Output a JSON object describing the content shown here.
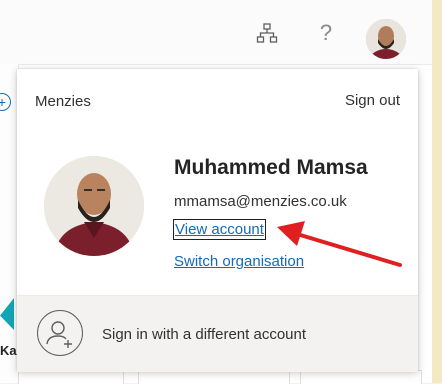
{
  "topbar": {
    "org_icon": "org-chart-icon",
    "help_icon": "question-mark-icon",
    "help_glyph": "?",
    "avatar": "user-avatar"
  },
  "background": {
    "left_text": "Ka",
    "left_plus": "+"
  },
  "account_panel": {
    "organisation": "Menzies",
    "sign_out_label": "Sign out",
    "user_name": "Muhammed Mamsa",
    "user_email": "mmamsa@menzies.co.uk",
    "view_account_label": "View account",
    "switch_org_label": "Switch organisation",
    "other_account_label": "Sign in with a different account",
    "annotation_arrow_color": "#e02020",
    "link_color": "#0f6cbd"
  }
}
